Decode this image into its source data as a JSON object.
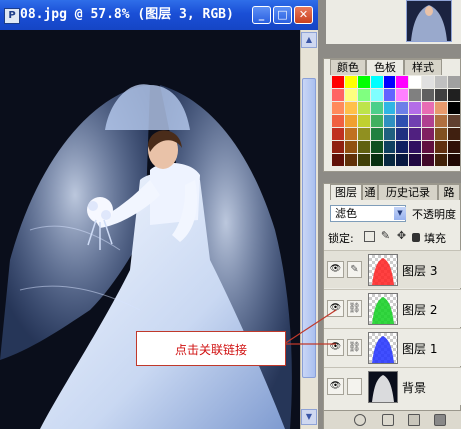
{
  "document": {
    "title": "08.jpg @ 57.8% (图层 3, RGB)",
    "app_icon": "photoshop-doc-icon",
    "controls": {
      "minimize": "_",
      "maximize": "□",
      "close": "✕"
    }
  },
  "swatches": {
    "tabs": [
      "颜色",
      "色板",
      "样式"
    ],
    "active_tab": "色板",
    "colors": [
      "#ff0000",
      "#ffff00",
      "#00ff00",
      "#00ffff",
      "#0000ff",
      "#ff00ff",
      "#ffffff",
      "#e0e0e0",
      "#c0c0c0",
      "#a0a0a0",
      "#ff6464",
      "#ffff80",
      "#80ff80",
      "#80ffff",
      "#6464ff",
      "#ff80ff",
      "#808080",
      "#606060",
      "#404040",
      "#202020",
      "#ff8a5c",
      "#ffc04a",
      "#bde44b",
      "#4ccf8a",
      "#2fb6e4",
      "#6d7fe8",
      "#b46de8",
      "#e86db4",
      "#e89a6d",
      "#000000",
      "#f06040",
      "#f0a030",
      "#c0d030",
      "#40b060",
      "#3090c0",
      "#3050b0",
      "#7040b0",
      "#b04090",
      "#b07040",
      "#604030",
      "#c03020",
      "#c07020",
      "#909020",
      "#208040",
      "#206080",
      "#203080",
      "#502080",
      "#802060",
      "#805020",
      "#402010",
      "#902010",
      "#905010",
      "#606010",
      "#105020",
      "#104060",
      "#102060",
      "#301060",
      "#601040",
      "#603010",
      "#301008",
      "#601008",
      "#603008",
      "#404008",
      "#083010",
      "#082840",
      "#081840",
      "#200840",
      "#400828",
      "#402008",
      "#200804"
    ]
  },
  "layers": {
    "tabs": [
      "图层",
      "通",
      "历史记录",
      "路"
    ],
    "active_tab": "图层",
    "blend_mode": "滤色",
    "opacity_label": "不透明度",
    "lock_label": "锁定:",
    "fill_label": "填充",
    "items": [
      {
        "name": "图层 3",
        "visible": true,
        "linked": false,
        "selected": true,
        "color": "#ff2020"
      },
      {
        "name": "图层 2",
        "visible": true,
        "linked": true,
        "selected": false,
        "color": "#10d020"
      },
      {
        "name": "图层 1",
        "visible": true,
        "linked": true,
        "selected": false,
        "color": "#2030ff"
      },
      {
        "name": "背景",
        "visible": true,
        "linked": false,
        "selected": false,
        "color": "#ffffff"
      }
    ]
  },
  "annotation": {
    "text": "点击关联链接"
  }
}
